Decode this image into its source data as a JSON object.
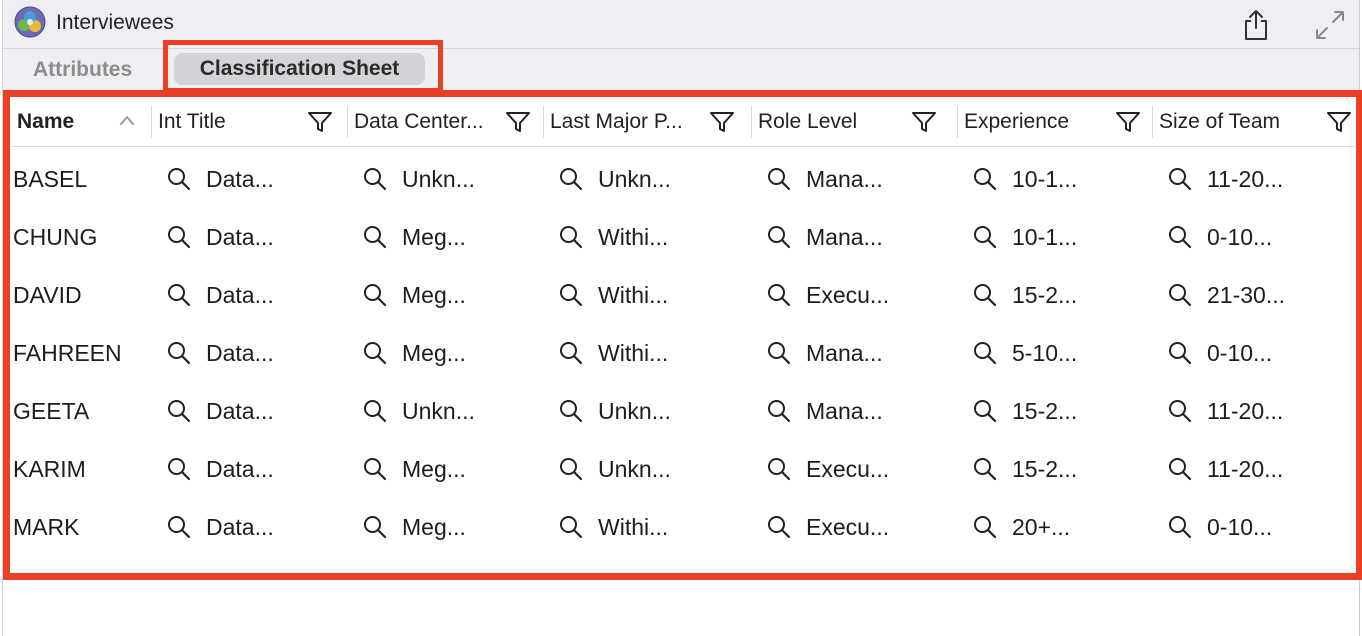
{
  "window": {
    "title": "Interviewees"
  },
  "tabs": {
    "attributes": "Attributes",
    "classification_sheet": "Classification Sheet"
  },
  "icons": {
    "app": "app-logo-icon",
    "share": "share-icon",
    "expand": "expand-icon",
    "filter": "filter-icon",
    "sort": "sort-ascending-icon",
    "cell": "magnifier-icon"
  },
  "colors": {
    "highlight": "#ea3f24",
    "tab_selected_bg": "#d5d3d7",
    "toolbar_bg": "#f1eef3"
  },
  "table": {
    "columns": [
      {
        "label": "Name"
      },
      {
        "label": "Int Title"
      },
      {
        "label": "Data Center..."
      },
      {
        "label": "Last Major P..."
      },
      {
        "label": "Role Level"
      },
      {
        "label": "Experience"
      },
      {
        "label": "Size of Team"
      }
    ],
    "rows": [
      {
        "name": "BASEL",
        "cells": [
          "Data...",
          "Unkn...",
          "Unkn...",
          "Mana...",
          "10-1...",
          "11-20..."
        ]
      },
      {
        "name": "CHUNG",
        "cells": [
          "Data...",
          "Meg...",
          "Withi...",
          "Mana...",
          "10-1...",
          "0-10..."
        ]
      },
      {
        "name": "DAVID",
        "cells": [
          "Data...",
          "Meg...",
          "Withi...",
          "Execu...",
          "15-2...",
          "21-30..."
        ]
      },
      {
        "name": "FAHREEN",
        "cells": [
          "Data...",
          "Meg...",
          "Withi...",
          "Mana...",
          "5-10...",
          "0-10..."
        ]
      },
      {
        "name": "GEETA",
        "cells": [
          "Data...",
          "Unkn...",
          "Unkn...",
          "Mana...",
          "15-2...",
          "11-20..."
        ]
      },
      {
        "name": "KARIM",
        "cells": [
          "Data...",
          "Meg...",
          "Unkn...",
          "Execu...",
          "15-2...",
          "11-20..."
        ]
      },
      {
        "name": "MARK",
        "cells": [
          "Data...",
          "Meg...",
          "Withi...",
          "Execu...",
          "20+...",
          "0-10..."
        ]
      }
    ]
  }
}
